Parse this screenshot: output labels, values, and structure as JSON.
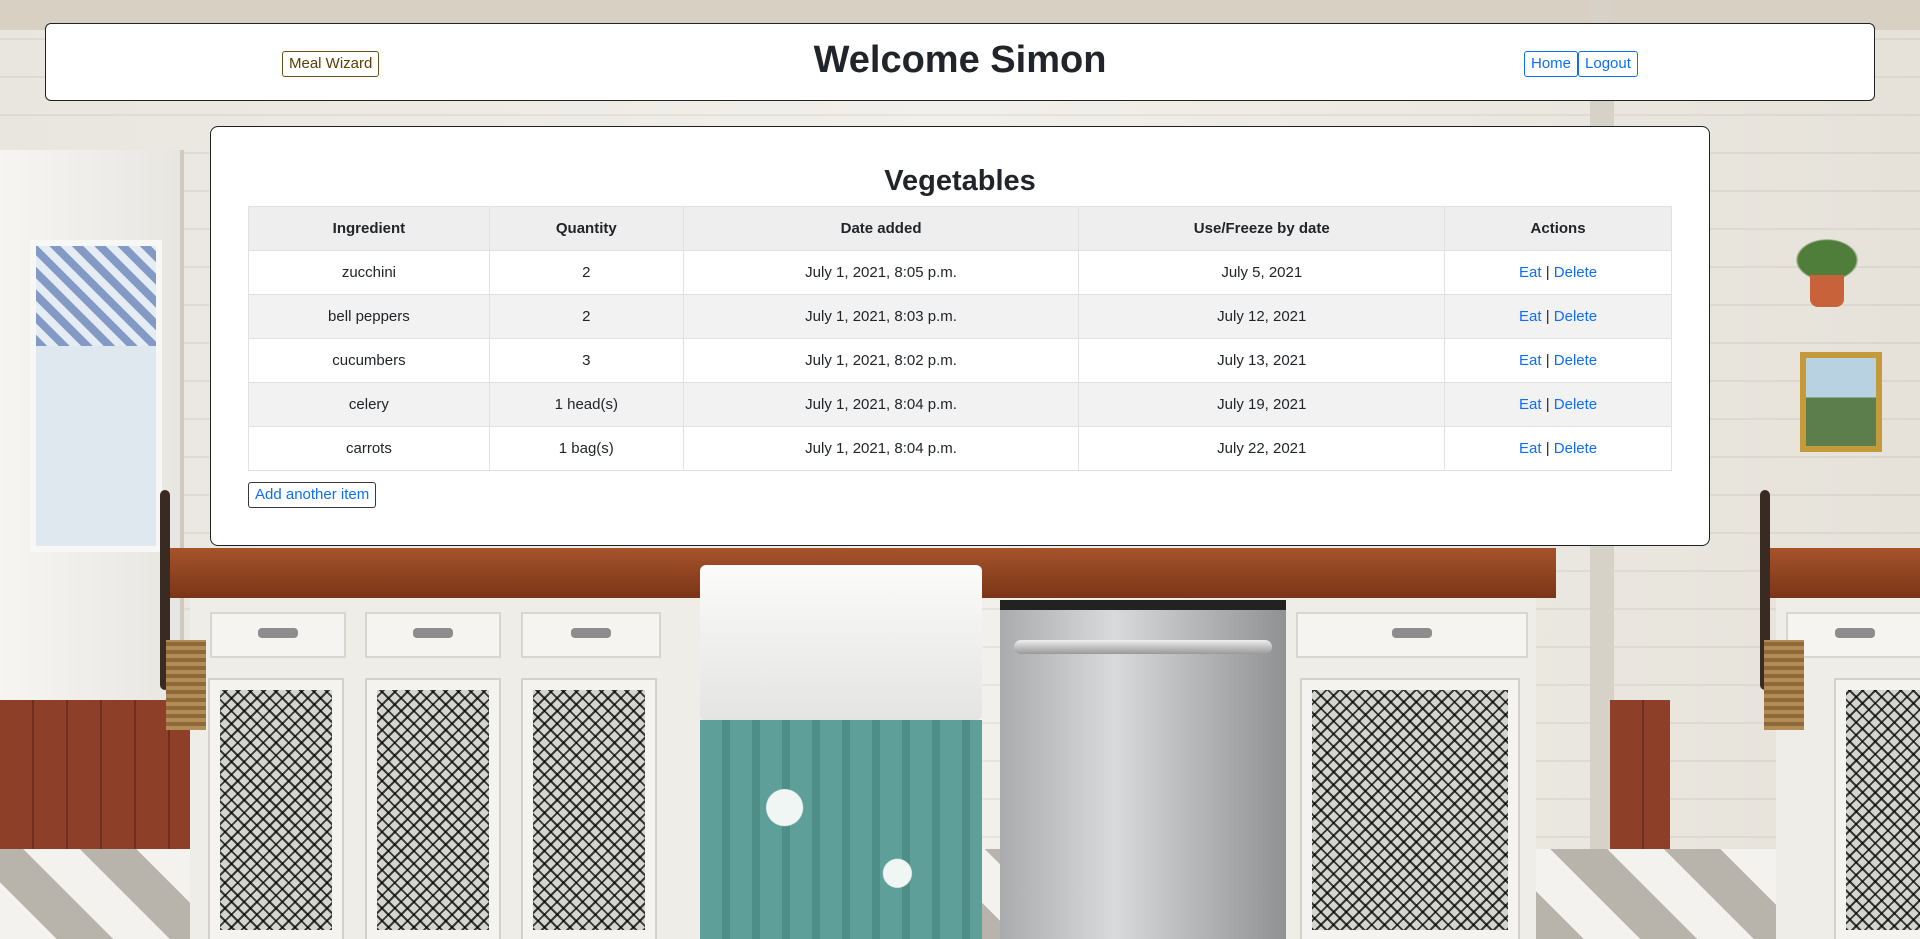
{
  "header": {
    "brand_label": "Meal Wizard",
    "title": "Welcome Simon",
    "nav": [
      {
        "label": "Home"
      },
      {
        "label": "Logout"
      }
    ]
  },
  "main": {
    "title": "Vegetables",
    "columns": [
      "Ingredient",
      "Quantity",
      "Date added",
      "Use/Freeze by date",
      "Actions"
    ],
    "rows": [
      {
        "ingredient": "zucchini",
        "quantity": "2",
        "date_added": "July 1, 2021, 8:05 p.m.",
        "use_by": "July 5, 2021"
      },
      {
        "ingredient": "bell peppers",
        "quantity": "2",
        "date_added": "July 1, 2021, 8:03 p.m.",
        "use_by": "July 12, 2021"
      },
      {
        "ingredient": "cucumbers",
        "quantity": "3",
        "date_added": "July 1, 2021, 8:02 p.m.",
        "use_by": "July 13, 2021"
      },
      {
        "ingredient": "celery",
        "quantity": "1 head(s)",
        "date_added": "July 1, 2021, 8:04 p.m.",
        "use_by": "July 19, 2021"
      },
      {
        "ingredient": "carrots",
        "quantity": "1 bag(s)",
        "date_added": "July 1, 2021, 8:04 p.m.",
        "use_by": "July 22, 2021"
      }
    ],
    "actions": {
      "eat_label": "Eat",
      "separator": "|",
      "delete_label": "Delete"
    },
    "add_label": "Add another item"
  },
  "colors": {
    "link": "#0d6efd",
    "brand": "#5b3f00",
    "header_row_bg": "#eeeeee"
  },
  "icons": []
}
